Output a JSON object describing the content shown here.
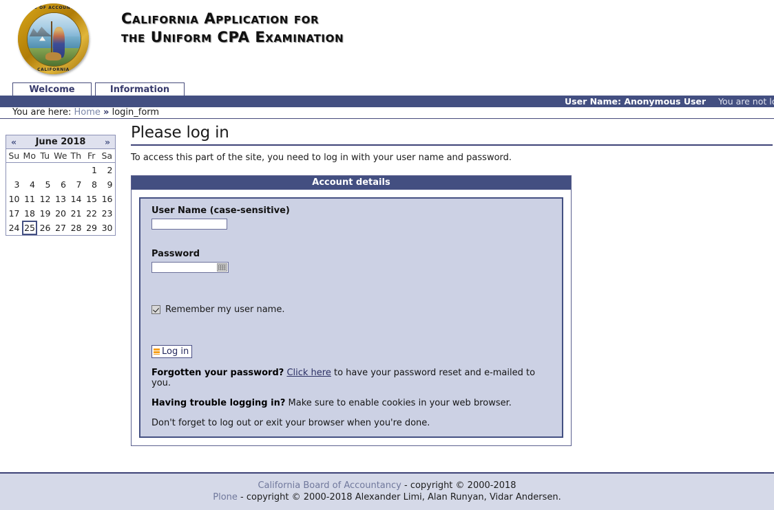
{
  "header": {
    "site_title": "California Application for\nthe Uniform CPA Examination",
    "logo_alt": "California Board of Accountancy seal",
    "seal_text_top": "BOARD OF ACCOUNTANCY",
    "seal_text_bottom": "CALIFORNIA"
  },
  "tabs": [
    {
      "label": "Welcome"
    },
    {
      "label": "Information"
    }
  ],
  "personal_bar": {
    "user_label": "User Name: Anonymous User",
    "status_note": "You are not logged in"
  },
  "breadcrumb": {
    "prefix": "You are here:",
    "home": "Home",
    "separator": "»",
    "current": "login_form"
  },
  "calendar": {
    "prev_label": "«",
    "next_label": "»",
    "title": "June 2018",
    "day_headers": [
      "Su",
      "Mo",
      "Tu",
      "We",
      "Th",
      "Fr",
      "Sa"
    ],
    "weeks": [
      [
        "",
        "",
        "",
        "",
        "",
        "1",
        "2"
      ],
      [
        "3",
        "4",
        "5",
        "6",
        "7",
        "8",
        "9"
      ],
      [
        "10",
        "11",
        "12",
        "13",
        "14",
        "15",
        "16"
      ],
      [
        "17",
        "18",
        "19",
        "20",
        "21",
        "22",
        "23"
      ],
      [
        "24",
        "25",
        "26",
        "27",
        "28",
        "29",
        "30"
      ]
    ],
    "today": "25"
  },
  "main": {
    "page_title": "Please log in",
    "page_description": "To access this part of the site, you need to log in with your user name and password.",
    "form": {
      "legend": "Account details",
      "username_label": "User Name (case-sensitive)",
      "username_value": "",
      "password_label": "Password",
      "password_value": "",
      "remember_label": "Remember my user name.",
      "remember_checked": true,
      "login_button": "Log in",
      "forgot_bold": "Forgotten your password?",
      "forgot_link": "Click here",
      "forgot_rest": " to have your password reset and e-mailed to you.",
      "trouble_bold": "Having trouble logging in?",
      "trouble_rest": " Make sure to enable cookies in your web browser.",
      "logout_note": "Don't forget to log out or exit your browser when you're done."
    }
  },
  "footer": {
    "line1_link": "California Board of Accountancy",
    "line1_rest": " - copyright © 2000-2018",
    "line2_link": "Plone",
    "line2_rest": " - copyright © 2000-2018 Alexander Limi, Alan Runyan, Vidar Andersen."
  },
  "colors": {
    "navy": "#434f81",
    "lavender": "#ccd1e4",
    "footer_bg": "#d5d9e8",
    "accent_orange": "#f7a01c"
  }
}
